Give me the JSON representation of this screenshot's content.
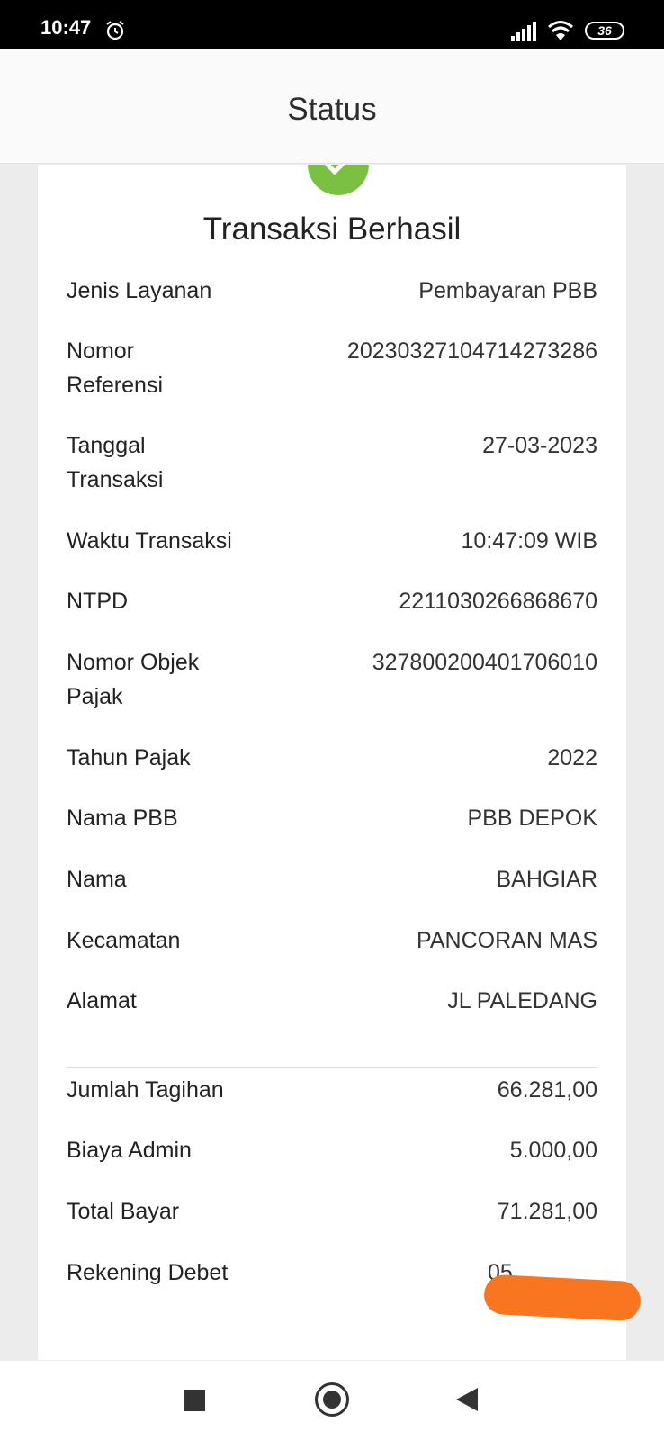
{
  "status_bar": {
    "time": "10:47",
    "battery": "36"
  },
  "appbar": {
    "title": "Status"
  },
  "receipt": {
    "status_title": "Transaksi Berhasil",
    "rows": [
      {
        "label": "Jenis Layanan",
        "value": "Pembayaran PBB"
      },
      {
        "label": "Nomor Referensi",
        "value": "20230327104714273286"
      },
      {
        "label": "Tanggal Transaksi",
        "value": "27-03-2023"
      },
      {
        "label": "Waktu Transaksi",
        "value": "10:47:09 WIB"
      },
      {
        "label": "NTPD",
        "value": "2211030266868670"
      },
      {
        "label": "Nomor Objek Pajak",
        "value": "327800200401706010"
      },
      {
        "label": "Tahun Pajak",
        "value": "2022"
      },
      {
        "label": "Nama PBB",
        "value": "PBB DEPOK"
      },
      {
        "label": "Nama",
        "value": "BAHGIAR"
      },
      {
        "label": "Kecamatan",
        "value": "PANCORAN MAS"
      },
      {
        "label": "Alamat",
        "value": "JL PALEDANG"
      }
    ],
    "summary": [
      {
        "label": "Jumlah Tagihan",
        "value": "66.281,00"
      },
      {
        "label": "Biaya Admin",
        "value": "5.000,00"
      },
      {
        "label": "Total Bayar",
        "value": "71.281,00"
      },
      {
        "label": "Rekening Debet",
        "value": "05"
      }
    ]
  },
  "colors": {
    "success": "#7ac143",
    "redaction": "#f97520"
  },
  "icons": [
    "alarm-icon",
    "signal-icon",
    "wifi-icon",
    "battery-icon",
    "check-icon",
    "recents-icon",
    "home-icon",
    "back-icon"
  ]
}
